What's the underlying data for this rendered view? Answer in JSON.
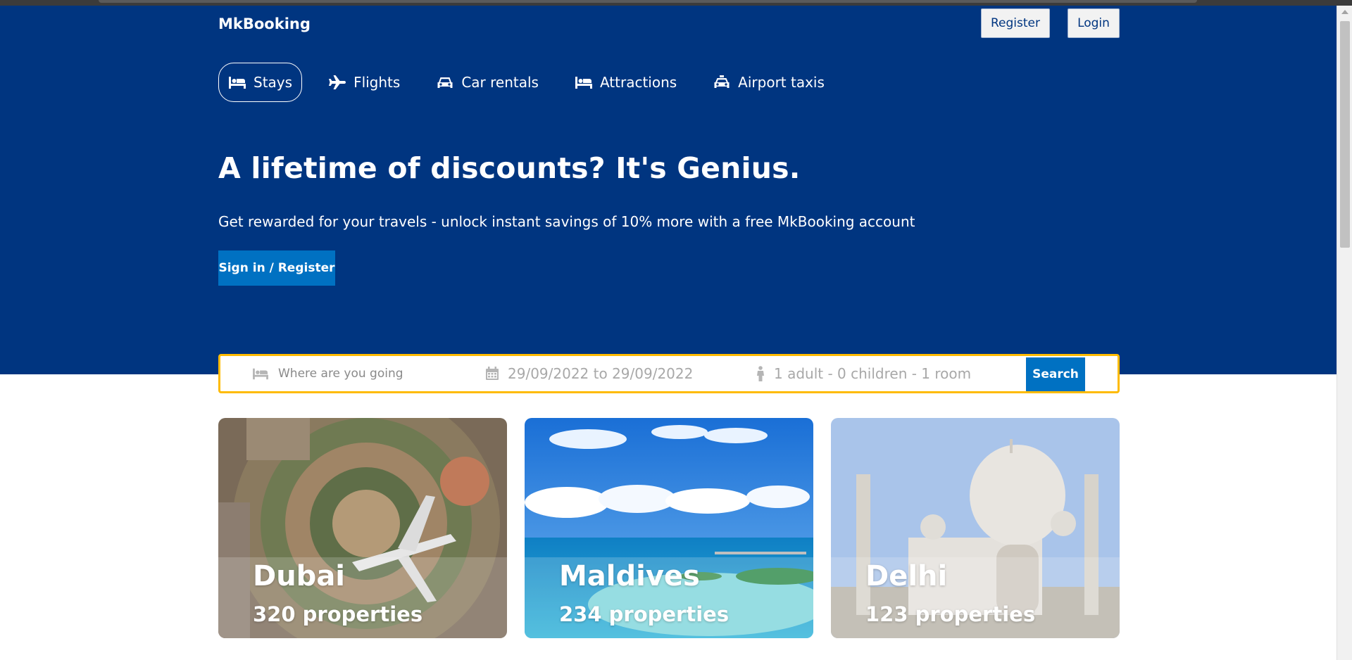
{
  "header": {
    "logo": "MkBooking",
    "register_label": "Register",
    "login_label": "Login"
  },
  "nav": {
    "items": [
      {
        "label": "Stays",
        "icon": "bed-icon",
        "active": true
      },
      {
        "label": "Flights",
        "icon": "plane-icon",
        "active": false
      },
      {
        "label": "Car rentals",
        "icon": "car-icon",
        "active": false
      },
      {
        "label": "Attractions",
        "icon": "bed-icon",
        "active": false
      },
      {
        "label": "Airport taxis",
        "icon": "taxi-icon",
        "active": false
      }
    ]
  },
  "hero": {
    "title": "A lifetime of discounts? It's Genius.",
    "subtitle": "Get rewarded for your travels - unlock instant savings of 10% more with a free MkBooking account",
    "cta_label": "Sign in / Register"
  },
  "search": {
    "destination_placeholder": "Where are you going",
    "destination_value": "",
    "dates": "29/09/2022 to 29/09/2022",
    "guests": "1 adult - 0 children - 1 room",
    "button_label": "Search"
  },
  "featured": [
    {
      "city": "Dubai",
      "properties": "320 properties"
    },
    {
      "city": "Maldives",
      "properties": "234 properties"
    },
    {
      "city": "Delhi",
      "properties": "123 properties"
    }
  ],
  "colors": {
    "hero_bg": "#003580",
    "primary_button": "#0071c2",
    "search_border": "#febb02"
  }
}
